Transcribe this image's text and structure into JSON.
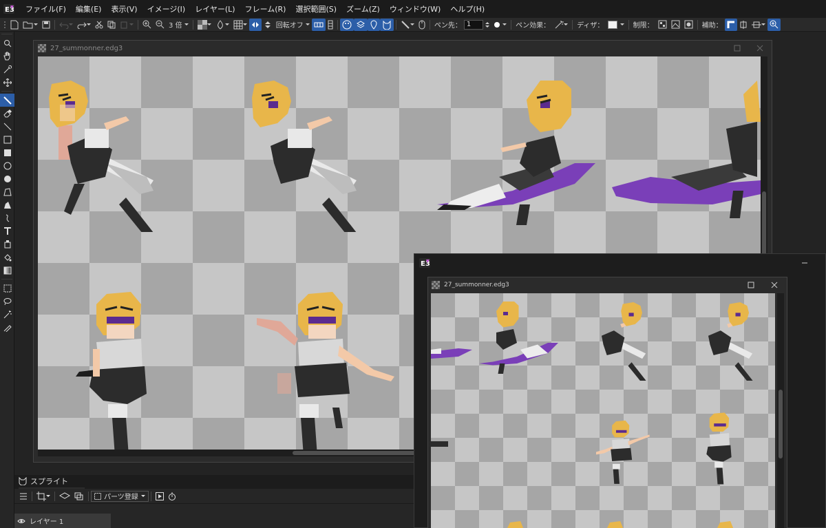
{
  "menubar": {
    "items": [
      "ファイル(F)",
      "編集(E)",
      "表示(V)",
      "イメージ(I)",
      "レイヤー(L)",
      "フレーム(R)",
      "選択範囲(S)",
      "ズーム(Z)",
      "ウィンドウ(W)",
      "ヘルプ(H)"
    ]
  },
  "toolbar": {
    "zoom_label": "3 倍",
    "rotate_label": "回転オフ",
    "pen_tip_label": "ペン先：",
    "pen_tip_value": "1",
    "pen_effect_label": "ペン効果：",
    "dither_label": "ディザ：",
    "limit_label": "制限：",
    "assist_label": "補助："
  },
  "main_window": {
    "filename": "27_summonner.edg3"
  },
  "preview_window": {
    "filename": "27_summonner.edg3"
  },
  "sprite_panel": {
    "title": "スプライト",
    "parts_register": "パーツ登録",
    "layer_name": "レイヤー 1"
  },
  "colors": {
    "accent": "#2c5ea8",
    "background": "#232323",
    "checker_light": "#c6c6c6",
    "checker_dark": "#a6a6a6",
    "hair": "#e8b64a",
    "purple": "#7a3fb8"
  }
}
